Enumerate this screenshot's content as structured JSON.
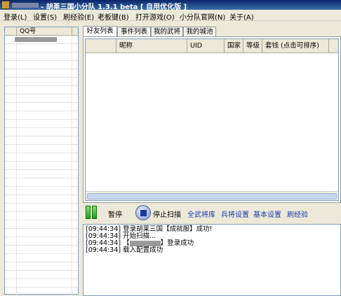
{
  "window": {
    "title": "- 胡莱三国小分队 1.3.1 beta [ 自用优化版 ]",
    "icon": "app-icon"
  },
  "menu": [
    {
      "id": "login",
      "label": "登录(L)"
    },
    {
      "id": "settings",
      "label": "设置(S)"
    },
    {
      "id": "grind",
      "label": "刷经验(E)"
    },
    {
      "id": "boss",
      "label": "老板键(B)"
    },
    {
      "id": "open-game",
      "label": "打开游戏(O)"
    },
    {
      "id": "website",
      "label": "小分队官网(N)"
    },
    {
      "id": "about",
      "label": "关于(A)"
    }
  ],
  "qq_list": {
    "header": "QQ号",
    "rows": 31
  },
  "tabs": [
    {
      "id": "friends",
      "label": "好友列表",
      "active": true
    },
    {
      "id": "events",
      "label": "事件列表",
      "active": false
    },
    {
      "id": "generals",
      "label": "我的武将",
      "active": false
    },
    {
      "id": "cities",
      "label": "我的城池",
      "active": false
    }
  ],
  "friends_grid": {
    "columns": [
      "",
      "昵称",
      "UID",
      "国家",
      "等级",
      "套钱 (点击可排序)"
    ],
    "rows": []
  },
  "toolbar": {
    "pause": "暂停",
    "stop": "停止扫描",
    "links": [
      {
        "id": "all-generals",
        "label": "全武将库"
      },
      {
        "id": "troop-settings",
        "label": "兵将设置"
      },
      {
        "id": "basic-settings",
        "label": "基本设置"
      },
      {
        "id": "grind-exp",
        "label": "刷经验"
      }
    ],
    "status_color": "#1ca01c",
    "link_color": "#1a3ab0"
  },
  "log": [
    {
      "time": "[09:44:34]",
      "text": "登录胡莱三国【成就服】成功!"
    },
    {
      "time": "[09:44:34]",
      "text": "开始扫描..."
    },
    {
      "time": "[09:44:34]",
      "text": "】登录成功",
      "prefix": "【"
    },
    {
      "time": "[09:44:34]",
      "text": "载入配置成功"
    }
  ]
}
